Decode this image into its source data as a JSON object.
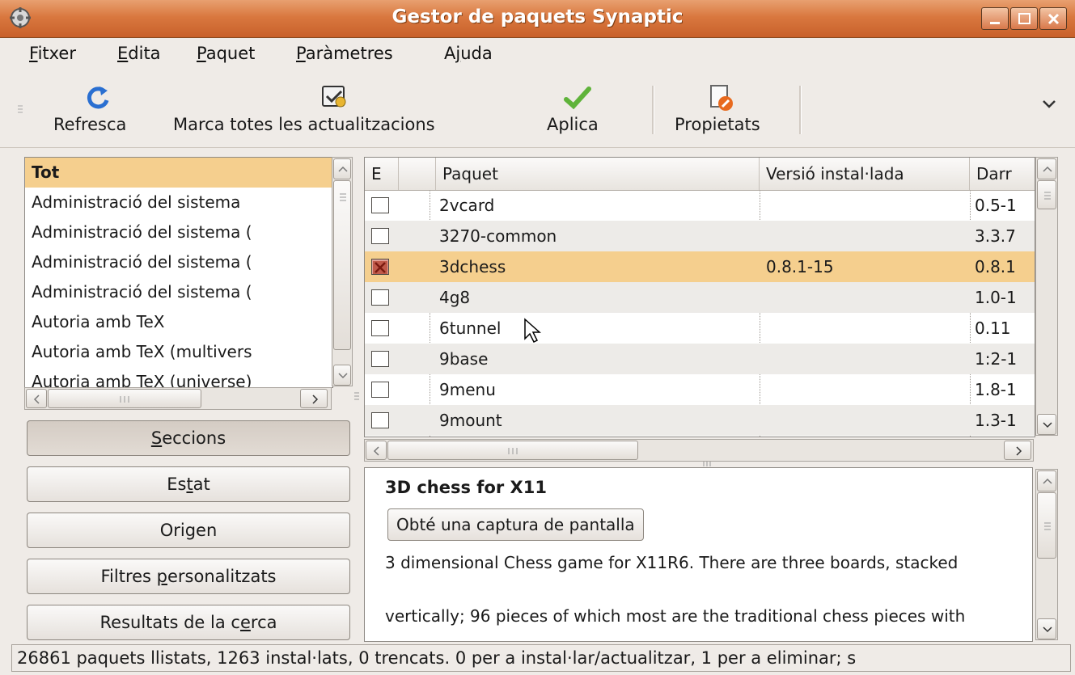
{
  "window": {
    "title": "Gestor de paquets Synaptic",
    "colors": {
      "titlebar": "#d9783f",
      "selection": "#f5cf8e",
      "background": "#efebe7"
    }
  },
  "menubar": [
    {
      "pre": "",
      "u": "F",
      "post": "itxer"
    },
    {
      "pre": "",
      "u": "E",
      "post": "dita"
    },
    {
      "pre": "",
      "u": "P",
      "post": "aquet"
    },
    {
      "pre": "",
      "u": "P",
      "post": "aràmetres"
    },
    {
      "pre": "A",
      "u": "j",
      "post": "uda"
    }
  ],
  "toolbar": {
    "refresh_label": "Refresca",
    "mark_all_label": "Marca totes les actualitzacions",
    "apply_label": "Aplica",
    "properties_label": "Propietats"
  },
  "sections": {
    "items": [
      "Tot",
      "Administració del sistema",
      "Administració del sistema (",
      "Administració del sistema (",
      "Administració del sistema (",
      "Autoria amb TeX",
      "Autoria amb TeX (multivers",
      "Autoria amb TeX (universe)"
    ],
    "selected_index": 0
  },
  "filter_buttons": {
    "sections": {
      "pre": "",
      "u": "S",
      "post": "eccions"
    },
    "status": {
      "pre": "Es",
      "u": "t",
      "post": "at"
    },
    "origin": {
      "pre": "",
      "u": "",
      "post": "Origen"
    },
    "custom": {
      "pre": "Filtres ",
      "u": "p",
      "post": "ersonalitzats"
    },
    "search": {
      "pre": "Resultats de la c",
      "u": "e",
      "post": "rca"
    }
  },
  "package_table": {
    "columns": [
      "E",
      "",
      "Paquet",
      "Versió instal·lada",
      "Darr"
    ],
    "rows": [
      {
        "name": "2vcard",
        "installed": "",
        "latest": "0.5-1",
        "status": "none"
      },
      {
        "name": "3270-common",
        "installed": "",
        "latest": "3.3.7",
        "status": "none"
      },
      {
        "name": "3dchess",
        "installed": "0.8.1-15",
        "latest": "0.8.1",
        "status": "marked-removal"
      },
      {
        "name": "4g8",
        "installed": "",
        "latest": "1.0-1",
        "status": "none"
      },
      {
        "name": "6tunnel",
        "installed": "",
        "latest": "0.11",
        "status": "none"
      },
      {
        "name": "9base",
        "installed": "",
        "latest": "1:2-1",
        "status": "none"
      },
      {
        "name": "9menu",
        "installed": "",
        "latest": "1.8-1",
        "status": "none"
      },
      {
        "name": "9mount",
        "installed": "",
        "latest": "1.3-1",
        "status": "none"
      }
    ],
    "selected_index": 2
  },
  "description": {
    "title": "3D chess for X11",
    "screenshot_button": "Obté una captura de pantalla",
    "para1": "3 dimensional Chess game for X11R6.  There are three boards, stacked",
    "para2": "vertically; 96 pieces of which most are the traditional chess pieces with"
  },
  "statusbar": {
    "text": "26861 paquets llistats, 1263 instal·lats, 0 trencats. 0 per a instal·lar/actualitzar, 1 per a eliminar; s"
  },
  "icons": [
    "synaptic-app-icon",
    "minimize-icon",
    "maximize-icon",
    "close-icon",
    "refresh-icon",
    "mark-upgrades-icon",
    "apply-checkmark-icon",
    "properties-icon",
    "toolbar-overflow-chevron-icon",
    "mouse-cursor-icon"
  ]
}
